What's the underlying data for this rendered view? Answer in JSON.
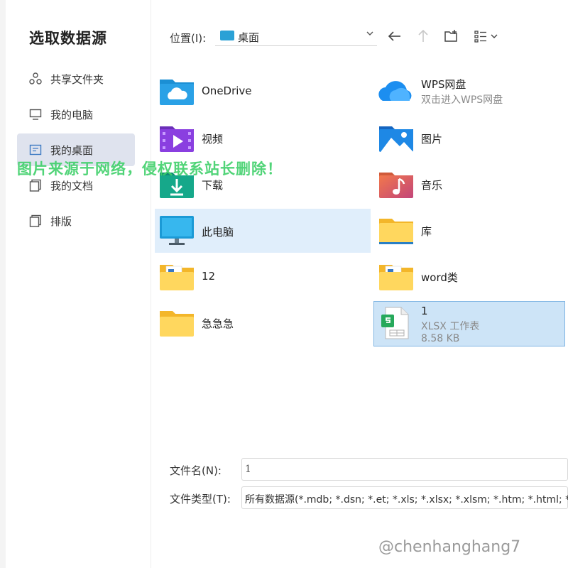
{
  "dialog": {
    "title": "选取数据源",
    "watermark": "图片来源于网络，侵权联系站长删除！",
    "credit": "@chenhanghang7"
  },
  "sidebar": {
    "items": [
      {
        "label": "共享文件夹",
        "icon": "share-icon"
      },
      {
        "label": "我的电脑",
        "icon": "monitor-icon"
      },
      {
        "label": "我的桌面",
        "icon": "desktop-icon",
        "selected": true
      },
      {
        "label": "我的文档",
        "icon": "documents-icon"
      },
      {
        "label": "排版",
        "icon": "layout-icon"
      }
    ]
  },
  "location": {
    "label": "位置(I):",
    "value": "桌面"
  },
  "files": [
    {
      "name": "OneDrive",
      "icon": "onedrive-icon"
    },
    {
      "name": "WPS网盘",
      "sub": "双击进入WPS网盘",
      "icon": "wps-cloud-icon"
    },
    {
      "name": "视频",
      "icon": "videos-folder-icon"
    },
    {
      "name": "图片",
      "icon": "pictures-folder-icon"
    },
    {
      "name": "下载",
      "icon": "downloads-folder-icon"
    },
    {
      "name": "音乐",
      "icon": "music-folder-icon"
    },
    {
      "name": "此电脑",
      "icon": "this-pc-icon",
      "state": "hover"
    },
    {
      "name": "库",
      "icon": "library-folder-icon"
    },
    {
      "name": "12",
      "icon": "folder-icon"
    },
    {
      "name": "word类",
      "icon": "folder-icon"
    },
    {
      "name": "急急急",
      "icon": "folder-icon"
    },
    {
      "name": "1",
      "sub": "XLSX 工作表",
      "size": "8.58 KB",
      "icon": "xlsx-file-icon",
      "state": "selected"
    }
  ],
  "form": {
    "filename_label": "文件名(N):",
    "filename_value": "1",
    "filetype_label": "文件类型(T):",
    "filetype_value": "所有数据源(*.mdb; *.dsn; *.et; *.xls; *.xlsx; *.xlsm; *.htm; *.html; *"
  },
  "colors": {
    "accent": "#2aa1d6",
    "selected_nav": "#dfe3ee",
    "selected_tile": "#cde4f7",
    "watermark": "#3fd06a"
  }
}
